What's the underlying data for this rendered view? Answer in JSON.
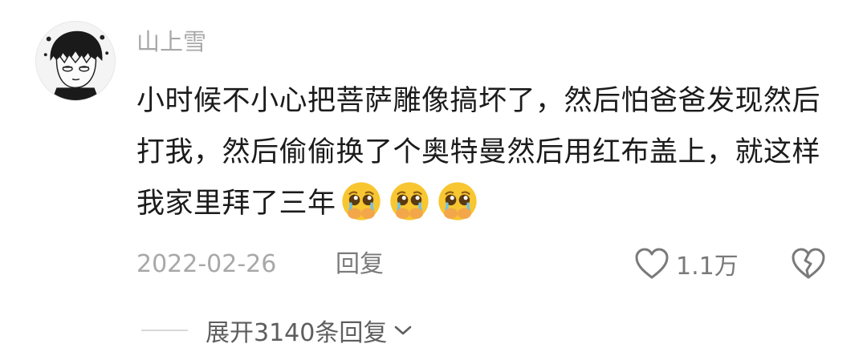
{
  "comment": {
    "username": "山上雪",
    "text": "小时候不小心把菩萨雕像搞坏了，然后怕爸爸发现然后打我，然后偷偷换了个奥特曼然后用红布盖上，就这样我家里拜了三年",
    "emoji_count": 3,
    "emoji_name": "pleading-crying-face",
    "date": "2022-02-26",
    "reply_label": "回复",
    "like_count": "1.1万",
    "expand_label": "展开3140条回复",
    "colors": {
      "text": "#1b1b1b",
      "meta": "#a8a8a8",
      "action": "#7a7a7a",
      "emoji": "#f7c631"
    }
  }
}
